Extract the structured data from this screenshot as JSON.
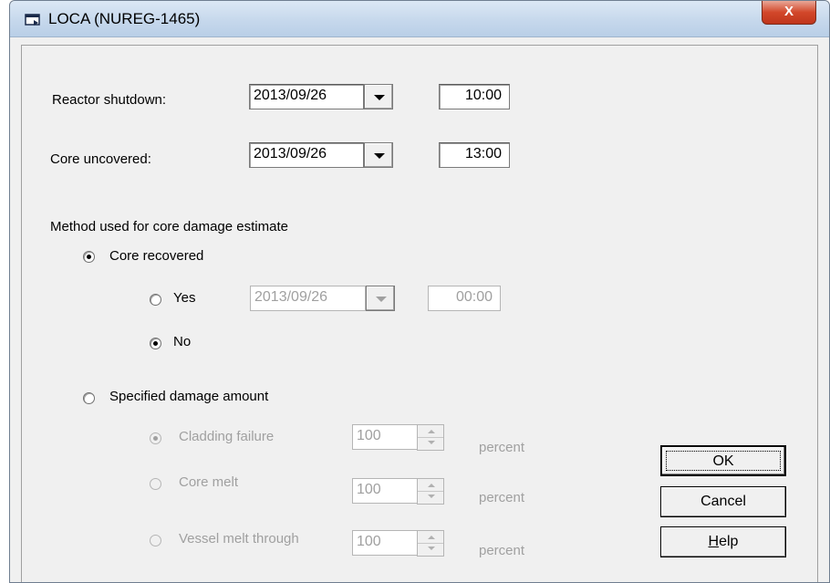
{
  "window": {
    "title": "LOCA (NUREG-1465)",
    "close_glyph": "X"
  },
  "reactor_shutdown": {
    "label": "Reactor shutdown:",
    "date": "2013/09/26",
    "time": "10:00"
  },
  "core_uncovered": {
    "label": "Core uncovered:",
    "date": "2013/09/26",
    "time": "13:00"
  },
  "method": {
    "heading": "Method used for core damage estimate",
    "core_recovered": {
      "label": "Core recovered",
      "selected": true,
      "yes": {
        "label": "Yes",
        "selected": false,
        "date": "2013/09/26",
        "time": "00:00",
        "enabled": false
      },
      "no": {
        "label": "No",
        "selected": true
      }
    },
    "specified_damage": {
      "label": "Specified damage amount",
      "selected": false,
      "options": [
        {
          "label": "Cladding failure",
          "value": "100",
          "unit": "percent",
          "selected": true
        },
        {
          "label": "Core melt",
          "value": "100",
          "unit": "percent",
          "selected": false
        },
        {
          "label": "Vessel melt through",
          "value": "100",
          "unit": "percent",
          "selected": false
        }
      ]
    }
  },
  "buttons": {
    "ok": "OK",
    "cancel": "Cancel",
    "help_mnemonic": "H",
    "help_rest": "elp"
  }
}
